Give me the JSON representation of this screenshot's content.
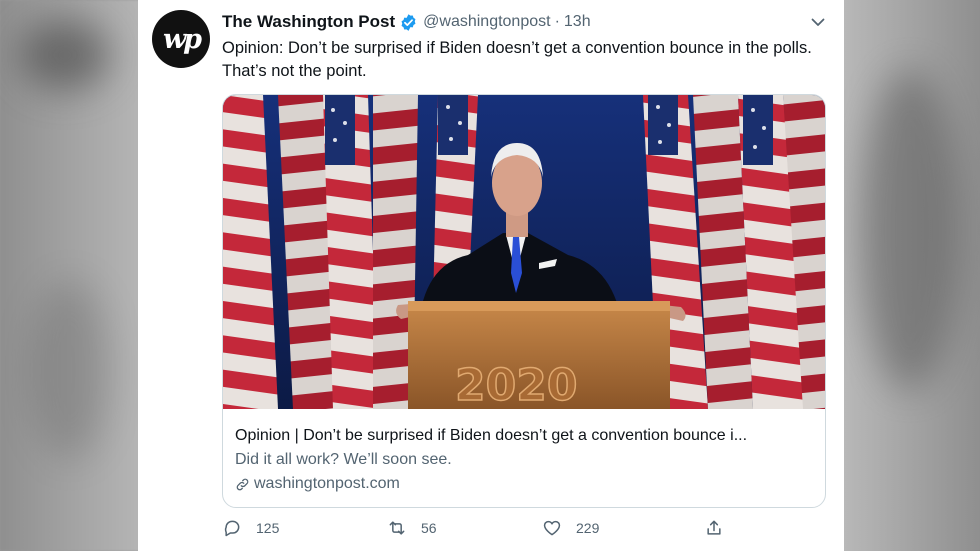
{
  "tweet": {
    "avatar_text": "wp",
    "author_name": "The Washington Post",
    "handle": "@washingtonpost",
    "separator": "·",
    "timestamp": "13h",
    "text": "Opinion: Don’t be surprised if Biden doesn’t get a convention bounce in the polls. That’s not the point.",
    "link_card": {
      "title": "Opinion | Don’t be surprised if Biden doesn’t get a convention bounce i...",
      "description": "Did it all work? We’ll soon see.",
      "domain": "washingtonpost.com"
    },
    "actions": {
      "replies": "125",
      "retweets": "56",
      "likes": "229"
    }
  },
  "colors": {
    "verified_blue": "#1d9bf0",
    "secondary_text": "#536471",
    "primary_text": "#0f1419",
    "flag_red": "#b22234",
    "background_blue": "#1c3a8a"
  },
  "icons": [
    "verified-badge-icon",
    "chevron-down-icon",
    "link-icon",
    "reply-icon",
    "retweet-icon",
    "like-icon",
    "share-icon"
  ]
}
